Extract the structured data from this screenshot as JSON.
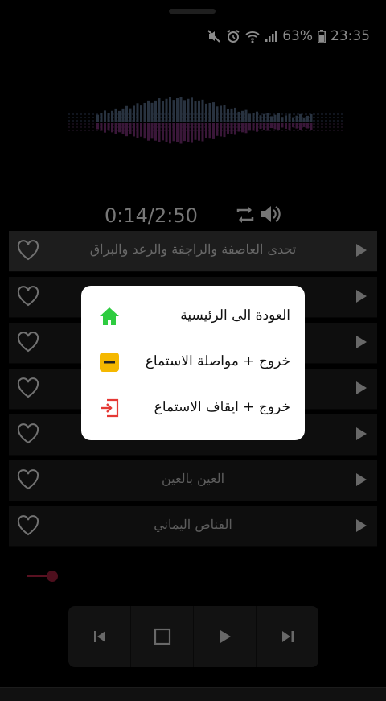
{
  "status": {
    "battery": "63%",
    "time": "23:35"
  },
  "player": {
    "elapsed": "0:14",
    "duration": "2:50",
    "time_display": "0:14/2:50",
    "seek_fraction": 0.082
  },
  "playlist": [
    {
      "title": "تحدى العاصفة والراجفة والرعد والبراق",
      "playing": true
    },
    {
      "title": "",
      "playing": false
    },
    {
      "title": "",
      "playing": false
    },
    {
      "title": "",
      "playing": false
    },
    {
      "title": "",
      "playing": false
    },
    {
      "title": "العين بالعين",
      "playing": false
    },
    {
      "title": "القناص اليماني",
      "playing": false
    }
  ],
  "dialog": {
    "items": [
      {
        "label": "العودة الى الرئيسية",
        "icon": "home-icon",
        "color": "#2ecc40"
      },
      {
        "label": "خروج + مواصلة الاستماع",
        "icon": "minimize-icon",
        "color": "#f5b800"
      },
      {
        "label": "خروج + ايقاف الاستماع",
        "icon": "exit-icon",
        "color": "#e53935"
      }
    ]
  },
  "colors": {
    "accent": "#a3203d",
    "row": "#1a1a1a",
    "row_active": "#353535"
  }
}
